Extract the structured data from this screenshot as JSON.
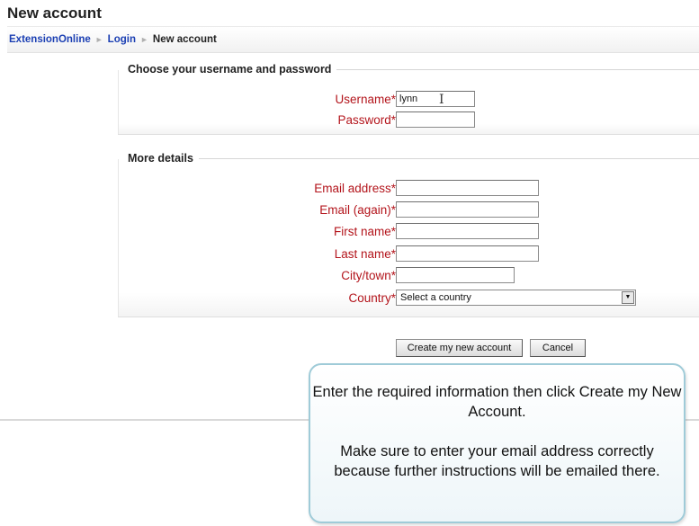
{
  "page": {
    "title": "New account"
  },
  "breadcrumb": {
    "items": [
      {
        "label": "ExtensionOnline"
      },
      {
        "label": "Login"
      }
    ],
    "current": "New account",
    "separator": "►"
  },
  "sections": {
    "account": {
      "legend": "Choose your username and password",
      "username": {
        "label": "Username*",
        "value": "lynn"
      },
      "password": {
        "label": "Password*",
        "value": ""
      }
    },
    "details": {
      "legend": "More details",
      "email": {
        "label": "Email address*",
        "value": ""
      },
      "email_again": {
        "label": "Email (again)*",
        "value": ""
      },
      "first_name": {
        "label": "First name*",
        "value": ""
      },
      "last_name": {
        "label": "Last name*",
        "value": ""
      },
      "city": {
        "label": "City/town*",
        "value": ""
      },
      "country": {
        "label": "Country*",
        "selected": "Select a country"
      }
    }
  },
  "buttons": {
    "create": "Create my new account",
    "cancel": "Cancel"
  },
  "callout": {
    "line1": "Enter the required information then click Create my New Account.",
    "line2": "Make sure to enter your email address correctly because further instructions will be emailed there."
  },
  "colors": {
    "required_label": "#b3141b",
    "link": "#1b3fb3",
    "callout_border": "#9fcbd8"
  }
}
